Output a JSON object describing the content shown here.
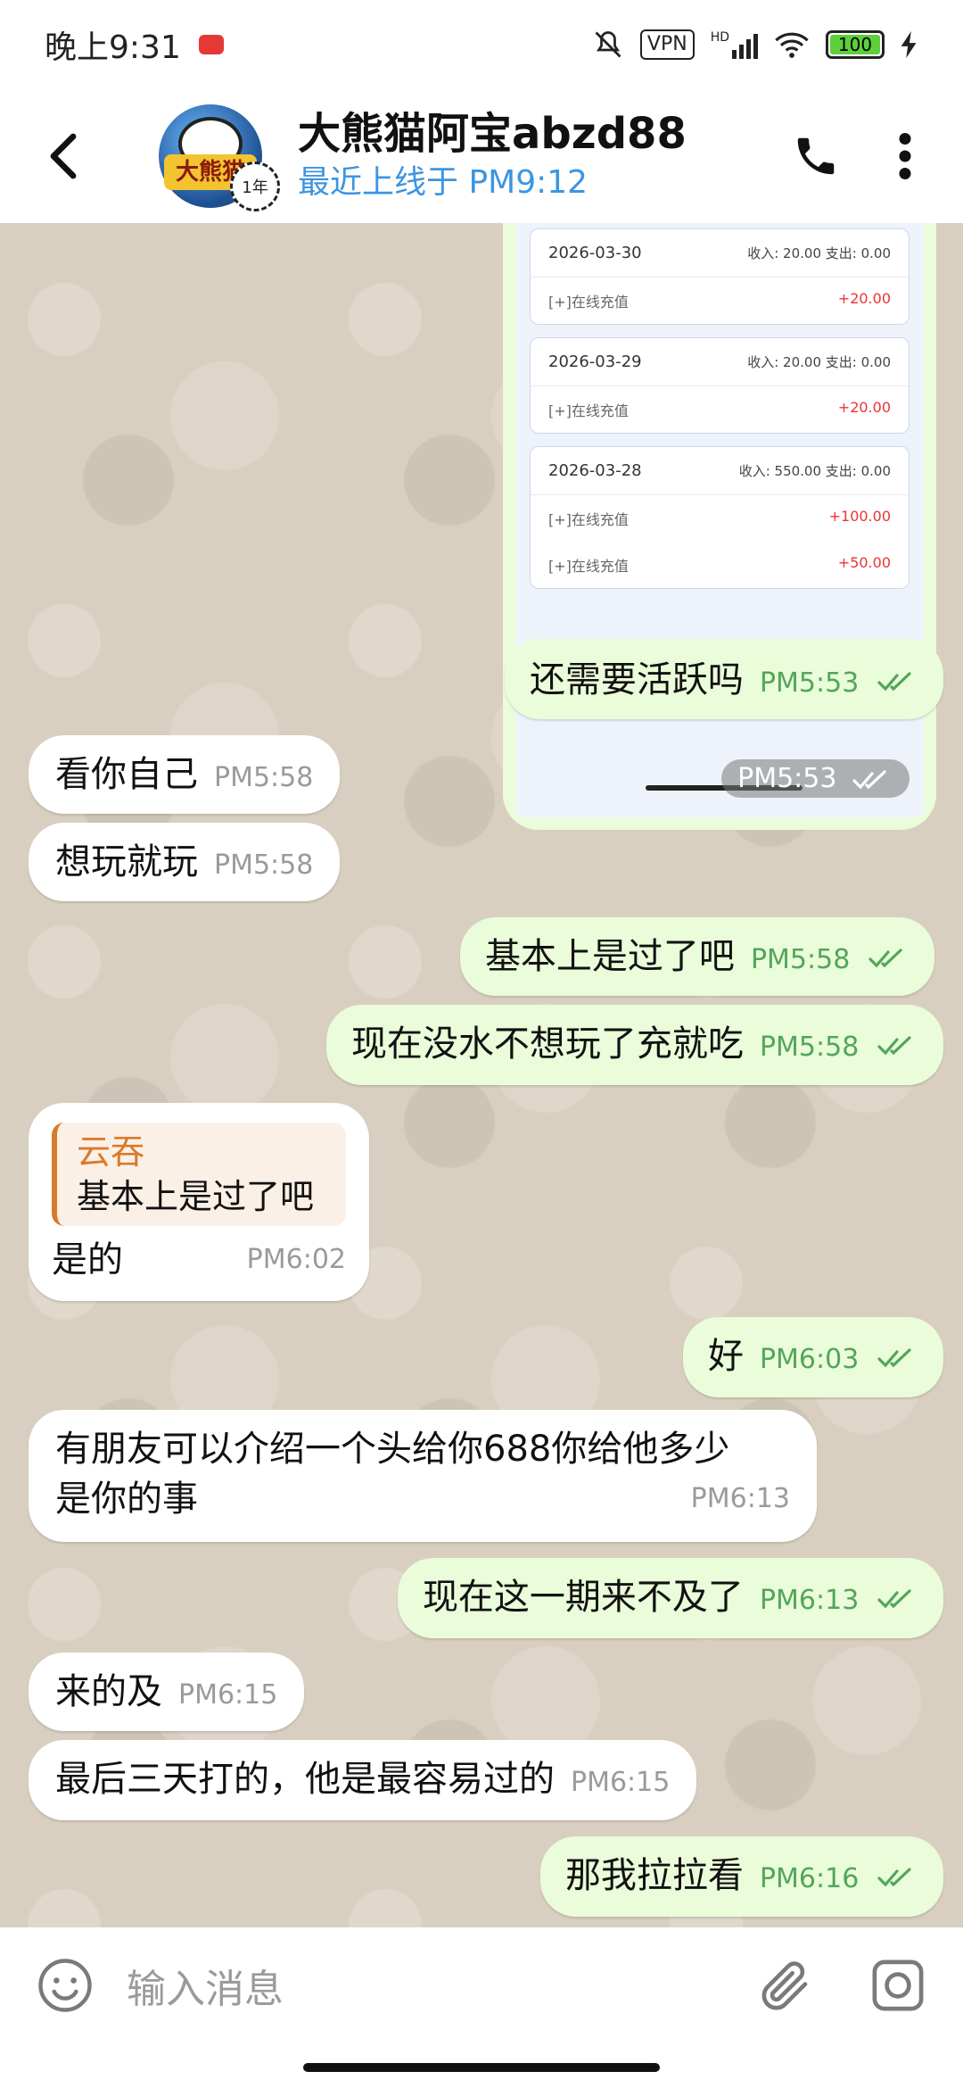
{
  "status_bar": {
    "time": "晚上9:31",
    "vpn": "VPN",
    "hd": "HD",
    "battery": "100"
  },
  "header": {
    "contact_name": "大熊猫阿宝abzd88",
    "last_seen": "最近上线于 PM9:12",
    "avatar_badge": "1年",
    "avatar_text": "大熊猫"
  },
  "shared_image": {
    "records": [
      {
        "date": "2026-03-30",
        "summary": "收入: 20.00 支出: 0.00",
        "rows": [
          {
            "label": "[+]在线充值",
            "amount": "+20.00"
          }
        ]
      },
      {
        "date": "2026-03-29",
        "summary": "收入: 20.00 支出: 0.00",
        "rows": [
          {
            "label": "[+]在线充值",
            "amount": "+20.00"
          }
        ]
      },
      {
        "date": "2026-03-28",
        "summary": "收入: 550.00 支出: 0.00",
        "rows": [
          {
            "label": "[+]在线充值",
            "amount": "+100.00"
          },
          {
            "label": "[+]在线充值",
            "amount": "+50.00"
          }
        ]
      }
    ],
    "time": "PM5:53"
  },
  "messages": [
    {
      "dir": "out",
      "text": "还需要活跃吗",
      "time": "PM5:53"
    },
    {
      "dir": "in",
      "text": "看你自己",
      "time": "PM5:58"
    },
    {
      "dir": "in",
      "text": "想玩就玩",
      "time": "PM5:58"
    },
    {
      "dir": "out",
      "text": "基本上是过了吧",
      "time": "PM5:58"
    },
    {
      "dir": "out",
      "text": "现在没水不想玩了充就吃",
      "time": "PM5:58"
    },
    {
      "dir": "in",
      "quote_name": "云吞",
      "quote_text": "基本上是过了吧",
      "text": "是的",
      "time": "PM6:02"
    },
    {
      "dir": "out",
      "text": "好",
      "time": "PM6:03"
    },
    {
      "dir": "in",
      "text_line1": "有朋友可以介绍一个头给你688你给他多少",
      "text_line2": "是你的事",
      "time": "PM6:13"
    },
    {
      "dir": "out",
      "text": "现在这一期来不及了",
      "time": "PM6:13"
    },
    {
      "dir": "in",
      "text": "来的及",
      "time": "PM6:15"
    },
    {
      "dir": "in",
      "text": "最后三天打的，他是最容易过的",
      "time": "PM6:15"
    },
    {
      "dir": "out",
      "text": "那我拉拉看",
      "time": "PM6:16"
    }
  ],
  "input": {
    "placeholder": "输入消息"
  },
  "colors": {
    "outgoing_bubble": "#eafcd9",
    "incoming_bubble": "#ffffff",
    "accent_blue": "#3d95e0",
    "quote_orange": "#d97a2b",
    "chat_background": "#d9cfc0"
  }
}
